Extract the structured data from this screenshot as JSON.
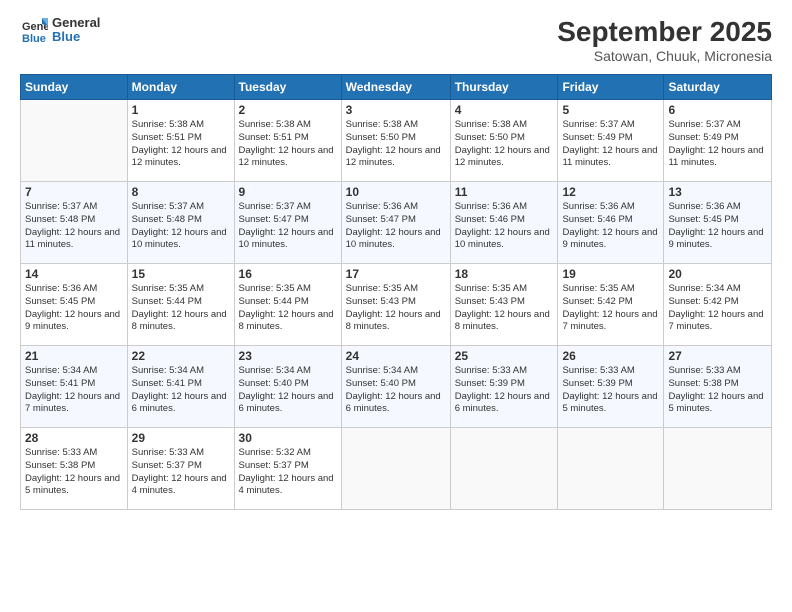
{
  "header": {
    "logo_line1": "General",
    "logo_line2": "Blue",
    "main_title": "September 2025",
    "subtitle": "Satowan, Chuuk, Micronesia"
  },
  "days_of_week": [
    "Sunday",
    "Monday",
    "Tuesday",
    "Wednesday",
    "Thursday",
    "Friday",
    "Saturday"
  ],
  "weeks": [
    [
      {
        "day": "",
        "empty": true
      },
      {
        "day": "1",
        "sunrise": "5:38 AM",
        "sunset": "5:51 PM",
        "daylight": "12 hours and 12 minutes."
      },
      {
        "day": "2",
        "sunrise": "5:38 AM",
        "sunset": "5:51 PM",
        "daylight": "12 hours and 12 minutes."
      },
      {
        "day": "3",
        "sunrise": "5:38 AM",
        "sunset": "5:50 PM",
        "daylight": "12 hours and 12 minutes."
      },
      {
        "day": "4",
        "sunrise": "5:38 AM",
        "sunset": "5:50 PM",
        "daylight": "12 hours and 12 minutes."
      },
      {
        "day": "5",
        "sunrise": "5:37 AM",
        "sunset": "5:49 PM",
        "daylight": "12 hours and 11 minutes."
      },
      {
        "day": "6",
        "sunrise": "5:37 AM",
        "sunset": "5:49 PM",
        "daylight": "12 hours and 11 minutes."
      }
    ],
    [
      {
        "day": "7",
        "sunrise": "5:37 AM",
        "sunset": "5:48 PM",
        "daylight": "12 hours and 11 minutes."
      },
      {
        "day": "8",
        "sunrise": "5:37 AM",
        "sunset": "5:48 PM",
        "daylight": "12 hours and 10 minutes."
      },
      {
        "day": "9",
        "sunrise": "5:37 AM",
        "sunset": "5:47 PM",
        "daylight": "12 hours and 10 minutes."
      },
      {
        "day": "10",
        "sunrise": "5:36 AM",
        "sunset": "5:47 PM",
        "daylight": "12 hours and 10 minutes."
      },
      {
        "day": "11",
        "sunrise": "5:36 AM",
        "sunset": "5:46 PM",
        "daylight": "12 hours and 10 minutes."
      },
      {
        "day": "12",
        "sunrise": "5:36 AM",
        "sunset": "5:46 PM",
        "daylight": "12 hours and 9 minutes."
      },
      {
        "day": "13",
        "sunrise": "5:36 AM",
        "sunset": "5:45 PM",
        "daylight": "12 hours and 9 minutes."
      }
    ],
    [
      {
        "day": "14",
        "sunrise": "5:36 AM",
        "sunset": "5:45 PM",
        "daylight": "12 hours and 9 minutes."
      },
      {
        "day": "15",
        "sunrise": "5:35 AM",
        "sunset": "5:44 PM",
        "daylight": "12 hours and 8 minutes."
      },
      {
        "day": "16",
        "sunrise": "5:35 AM",
        "sunset": "5:44 PM",
        "daylight": "12 hours and 8 minutes."
      },
      {
        "day": "17",
        "sunrise": "5:35 AM",
        "sunset": "5:43 PM",
        "daylight": "12 hours and 8 minutes."
      },
      {
        "day": "18",
        "sunrise": "5:35 AM",
        "sunset": "5:43 PM",
        "daylight": "12 hours and 8 minutes."
      },
      {
        "day": "19",
        "sunrise": "5:35 AM",
        "sunset": "5:42 PM",
        "daylight": "12 hours and 7 minutes."
      },
      {
        "day": "20",
        "sunrise": "5:34 AM",
        "sunset": "5:42 PM",
        "daylight": "12 hours and 7 minutes."
      }
    ],
    [
      {
        "day": "21",
        "sunrise": "5:34 AM",
        "sunset": "5:41 PM",
        "daylight": "12 hours and 7 minutes."
      },
      {
        "day": "22",
        "sunrise": "5:34 AM",
        "sunset": "5:41 PM",
        "daylight": "12 hours and 6 minutes."
      },
      {
        "day": "23",
        "sunrise": "5:34 AM",
        "sunset": "5:40 PM",
        "daylight": "12 hours and 6 minutes."
      },
      {
        "day": "24",
        "sunrise": "5:34 AM",
        "sunset": "5:40 PM",
        "daylight": "12 hours and 6 minutes."
      },
      {
        "day": "25",
        "sunrise": "5:33 AM",
        "sunset": "5:39 PM",
        "daylight": "12 hours and 6 minutes."
      },
      {
        "day": "26",
        "sunrise": "5:33 AM",
        "sunset": "5:39 PM",
        "daylight": "12 hours and 5 minutes."
      },
      {
        "day": "27",
        "sunrise": "5:33 AM",
        "sunset": "5:38 PM",
        "daylight": "12 hours and 5 minutes."
      }
    ],
    [
      {
        "day": "28",
        "sunrise": "5:33 AM",
        "sunset": "5:38 PM",
        "daylight": "12 hours and 5 minutes."
      },
      {
        "day": "29",
        "sunrise": "5:33 AM",
        "sunset": "5:37 PM",
        "daylight": "12 hours and 4 minutes."
      },
      {
        "day": "30",
        "sunrise": "5:32 AM",
        "sunset": "5:37 PM",
        "daylight": "12 hours and 4 minutes."
      },
      {
        "day": "",
        "empty": true
      },
      {
        "day": "",
        "empty": true
      },
      {
        "day": "",
        "empty": true
      },
      {
        "day": "",
        "empty": true
      }
    ]
  ]
}
